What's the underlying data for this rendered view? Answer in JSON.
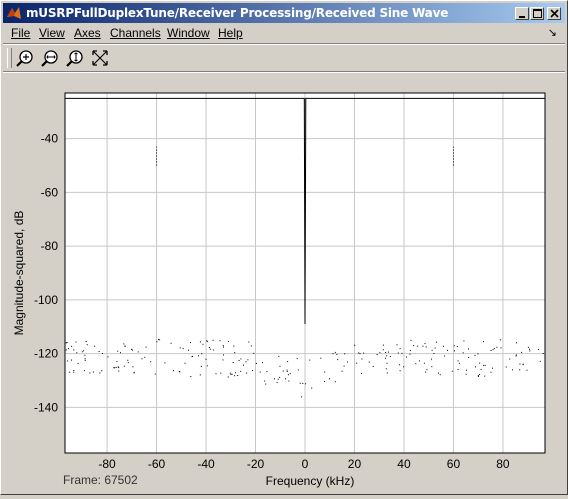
{
  "window": {
    "title": "mUSRPFullDuplexTune/Receiver Processing/Received Sine Wave"
  },
  "menu": {
    "items": [
      {
        "label": "File",
        "underline_first": true
      },
      {
        "label": "View",
        "underline_first": true
      },
      {
        "label": "Axes",
        "underline_first": true
      },
      {
        "label": "Channels",
        "underline_first": true
      },
      {
        "label": "Window",
        "underline_first": true
      },
      {
        "label": "Help",
        "underline_first": true
      }
    ]
  },
  "toolbar": {
    "tools": [
      "zoom-in-icon",
      "zoom-x-icon",
      "zoom-y-icon",
      "autoscale-icon"
    ]
  },
  "status": {
    "frame_label": "Frame: 67502"
  },
  "chart_data": {
    "type": "line",
    "xlabel": "Frequency (kHz)",
    "ylabel": "Magnitude-squared, dB",
    "xlim": [
      -97,
      97
    ],
    "ylim": [
      -157,
      -23
    ],
    "xticks": [
      -80,
      -60,
      -40,
      -20,
      0,
      20,
      40,
      60,
      80
    ],
    "yticks": [
      -40,
      -60,
      -80,
      -100,
      -120,
      -140
    ],
    "grid": true,
    "peaks": [
      {
        "x": -60,
        "y": -50
      },
      {
        "x": 60,
        "y": -50
      }
    ],
    "noise_floor": -120,
    "dc_spike": {
      "x": 0,
      "y": -109
    }
  }
}
